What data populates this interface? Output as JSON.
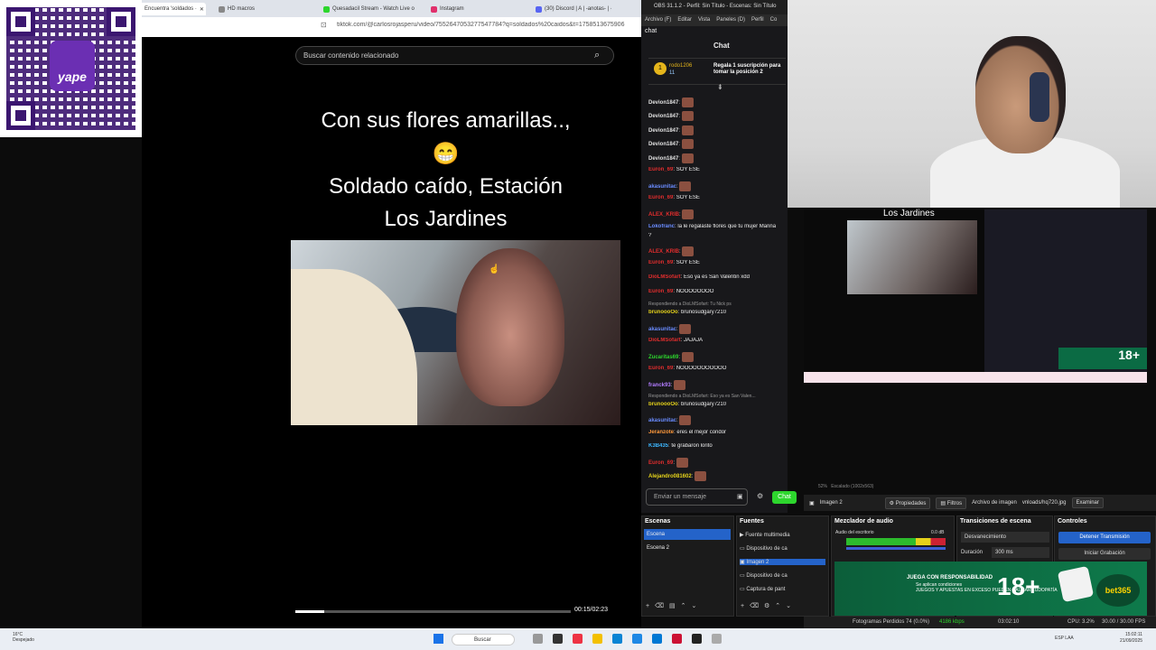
{
  "browser": {
    "tabs": [
      {
        "label": "Encuentra 'soldados ·",
        "color": "#222"
      },
      {
        "label": "HD macros",
        "color": "#888"
      },
      {
        "label": "Quesadacil Stream - Watch Live o",
        "color": "#2dd62d"
      },
      {
        "label": "Instagram",
        "color": "#e1306c"
      },
      {
        "label": "(30) Discord | A | -anotas- | ·",
        "color": "#5865f2"
      }
    ],
    "url": "tiktok.com/@carlosrojasperu/video/7552647053277547784?q=soldados%20caidos&t=1758513675906"
  },
  "qr": {
    "brand": "yape"
  },
  "tiktok": {
    "search_placeholder": "Buscar contenido relacionado",
    "caption_line1": "Con sus flores amarillas..,",
    "caption_emoji": "😁",
    "caption_line2": "Soldado caído, Estación",
    "caption_line3": "Los Jardines",
    "time": "00:15/02:23",
    "progress_fraction": 0.105
  },
  "obs_window": {
    "title": "OBS 31.1.2 - Perfil: Sin Título - Escenas: Sin Título",
    "menu": [
      "Archivo (F)",
      "Editar",
      "Vista",
      "Paneles (D)",
      "Perfil",
      "Co"
    ]
  },
  "chat": {
    "dock_label": "chat",
    "title": "Chat",
    "pinned": {
      "user": "rodo1206",
      "count": "11",
      "text": "Regala 1 suscripción para tomar la posición 2"
    },
    "messages": [
      {
        "user": "Devion1847",
        "color": "#e0e0e0",
        "text": "",
        "emote": true
      },
      {
        "user": "Devion1847",
        "color": "#e0e0e0",
        "text": "",
        "emote": true
      },
      {
        "user": "Devion1847",
        "color": "#e0e0e0",
        "text": "",
        "emote": true
      },
      {
        "user": "Devion1847",
        "color": "#e0e0e0",
        "text": "",
        "emote": true
      },
      {
        "user": "Devion1847",
        "color": "#e0e0e0",
        "text": "",
        "emote": true
      },
      {
        "user": "Euron_69",
        "color": "#e02d2d",
        "text": "SOY ESE",
        "emote": false
      },
      {
        "user": "akasunitac",
        "color": "#6a8cff",
        "text": "",
        "emote": true
      },
      {
        "user": "Euron_69",
        "color": "#e02d2d",
        "text": "SOY ESE",
        "emote": false
      },
      {
        "user": "ALEX_KRIB",
        "color": "#e02d2d",
        "text": "",
        "emote": true
      },
      {
        "user": "Lokofranc",
        "color": "#6a8cff",
        "text": "la le regalaste flores que tu mujer Marina",
        "emote": false
      },
      {
        "user": "",
        "color": "#e0e0e0",
        "text": "?",
        "emote": false
      },
      {
        "user": "ALEX_KRIB",
        "color": "#e02d2d",
        "text": "",
        "emote": true
      },
      {
        "user": "Euron_69",
        "color": "#e02d2d",
        "text": "SOY ESE",
        "emote": false
      },
      {
        "user": "DioLMSofart",
        "color": "#e02d2d",
        "text": "Eso ya es San Valentin xdd",
        "emote": false
      },
      {
        "user": "Euron_69",
        "color": "#e02d2d",
        "text": "NOOOOOOOO",
        "emote": false
      },
      {
        "user": "",
        "color": "#999",
        "text": "Respondiendo a DioLMSofart: Tu Nick ps",
        "emote": false,
        "reply": true
      },
      {
        "user": "brunoooOo",
        "color": "#e5d21b",
        "text": "brunosudgary7210",
        "emote": false
      },
      {
        "user": "akasunitac",
        "color": "#6a8cff",
        "text": "",
        "emote": true
      },
      {
        "user": "DioLMSofart",
        "color": "#e02d2d",
        "text": "JAJAJA",
        "emote": false
      },
      {
        "user": "Zucaritas69",
        "color": "#2dd62d",
        "text": "",
        "emote": true
      },
      {
        "user": "Euron_69",
        "color": "#e02d2d",
        "text": "NOOOOOOOOOOO",
        "emote": false
      },
      {
        "user": "franck93",
        "color": "#b27cff",
        "text": "",
        "emote": true
      },
      {
        "user": "",
        "color": "#999",
        "text": "Respondiendo a DioLMSofart: Eso ya es San Valen...",
        "emote": false,
        "reply": true
      },
      {
        "user": "brunoooOo",
        "color": "#e5d21b",
        "text": "brunosudgary7210",
        "emote": false
      },
      {
        "user": "akasunitac",
        "color": "#6a8cff",
        "text": "",
        "emote": true
      },
      {
        "user": "Jeranzote",
        "color": "#ff9a3c",
        "text": "eres el mejor condor",
        "emote": false
      },
      {
        "user": "K3B435",
        "color": "#3cb6ff",
        "text": "te grabaron lorito",
        "emote": false
      },
      {
        "user": "Euron_69",
        "color": "#e02d2d",
        "text": "",
        "emote": true
      },
      {
        "user": "Alejandro081602",
        "color": "#e5d21b",
        "text": "",
        "emote": true
      }
    ],
    "input_placeholder": "Enviar un mensaje",
    "send_label": "Chat"
  },
  "preview": {
    "title": "Los Jardines",
    "zoom": "52%",
    "scale": "Escalado (1002x563)",
    "bet18": "18+"
  },
  "toolbar": {
    "source": "Imagen 2",
    "properties": "Propiedades",
    "filters": "Filtros",
    "image_file": "Archivo de imagen",
    "file": "vnloads/hq720.jpg",
    "browse": "Examinar"
  },
  "docks": {
    "scenes": {
      "title": "Escenas",
      "items": [
        "Escena",
        "Escena 2"
      ]
    },
    "sources": {
      "title": "Fuentes",
      "items": [
        "Fuente multimedia",
        "Dispositivo de ca",
        "Imagen 2",
        "Dispositivo de ca",
        "Captura de pant"
      ]
    },
    "mixer": {
      "title": "Mezclador de audio",
      "track": "Audio del escritorio",
      "db": "0.0 dB"
    },
    "transitions": {
      "title": "Transiciones de escena",
      "type": "Desvanecimiento",
      "duration_label": "Duración",
      "duration": "300 ms"
    },
    "controls": {
      "title": "Controles",
      "stream": "Detener Transmisión",
      "record": "Iniciar Grabación"
    }
  },
  "bet365": {
    "line1": "JUEGA CON RESPONSABILIDAD",
    "line2": "Se aplican condiciones",
    "line3": "JUEGOS Y APUESTAS EN EXCESO PUEDEN CAUSAR LUDOPATÍA",
    "age": "18+",
    "brand": "bet365"
  },
  "status": {
    "frames": "Fotogramas Perdidos 74 (0.0%)",
    "bitrate": "4186 kbps",
    "time": "03:02:10",
    "cpu": "CPU: 3.2%",
    "fps": "30.00 / 30.00 FPS"
  },
  "taskbar": {
    "temp": "16°C",
    "weather": "Despejado",
    "search": "Buscar",
    "lang": "ESP LAA",
    "time": "15:02:11",
    "date": "21/09/2025"
  }
}
